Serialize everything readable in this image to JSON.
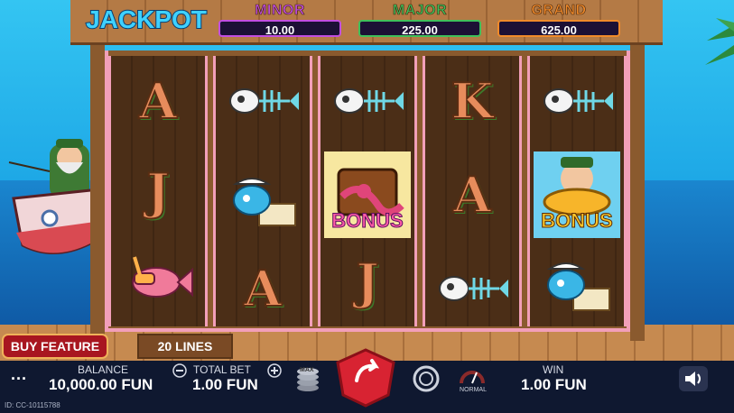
{
  "jackpot": {
    "logo": "JACKPOT",
    "minor": {
      "label": "MINOR",
      "value": "10.00",
      "color": "#c24ee0"
    },
    "major": {
      "label": "MAJOR",
      "value": "225.00",
      "color": "#3fbf5a"
    },
    "grand": {
      "label": "GRAND",
      "value": "625.00",
      "color": "#f08a2a"
    }
  },
  "reels": [
    [
      "A",
      "fish-skeleton",
      "J",
      "pink-fish-snorkel"
    ],
    [
      "fish-skeleton",
      "captain-fish",
      "A"
    ],
    [
      "fish-skeleton",
      "bonus-chest",
      "J"
    ],
    [
      "K",
      "A",
      "fish-skeleton"
    ],
    [
      "fish-skeleton",
      "bonus-fisherman",
      "captain-fish"
    ]
  ],
  "bonus_label": "BONUS",
  "buttons": {
    "buy_feature": "BUY FEATURE",
    "lines": "20 LINES",
    "max": "MAX",
    "mode": "NORMAL"
  },
  "footer": {
    "menu": "···",
    "balance_label": "BALANCE",
    "balance_value": "10,000.00 FUN",
    "bet_label": "TOTAL BET",
    "bet_value": "1.00 FUN",
    "win_label": "WIN",
    "win_value": "1.00 FUN",
    "session_id": "ID: CC-10115788"
  },
  "colors": {
    "reel_frame": "#f29fb9",
    "spin_button": "#d82332",
    "footer_bg": "#0f1830"
  }
}
